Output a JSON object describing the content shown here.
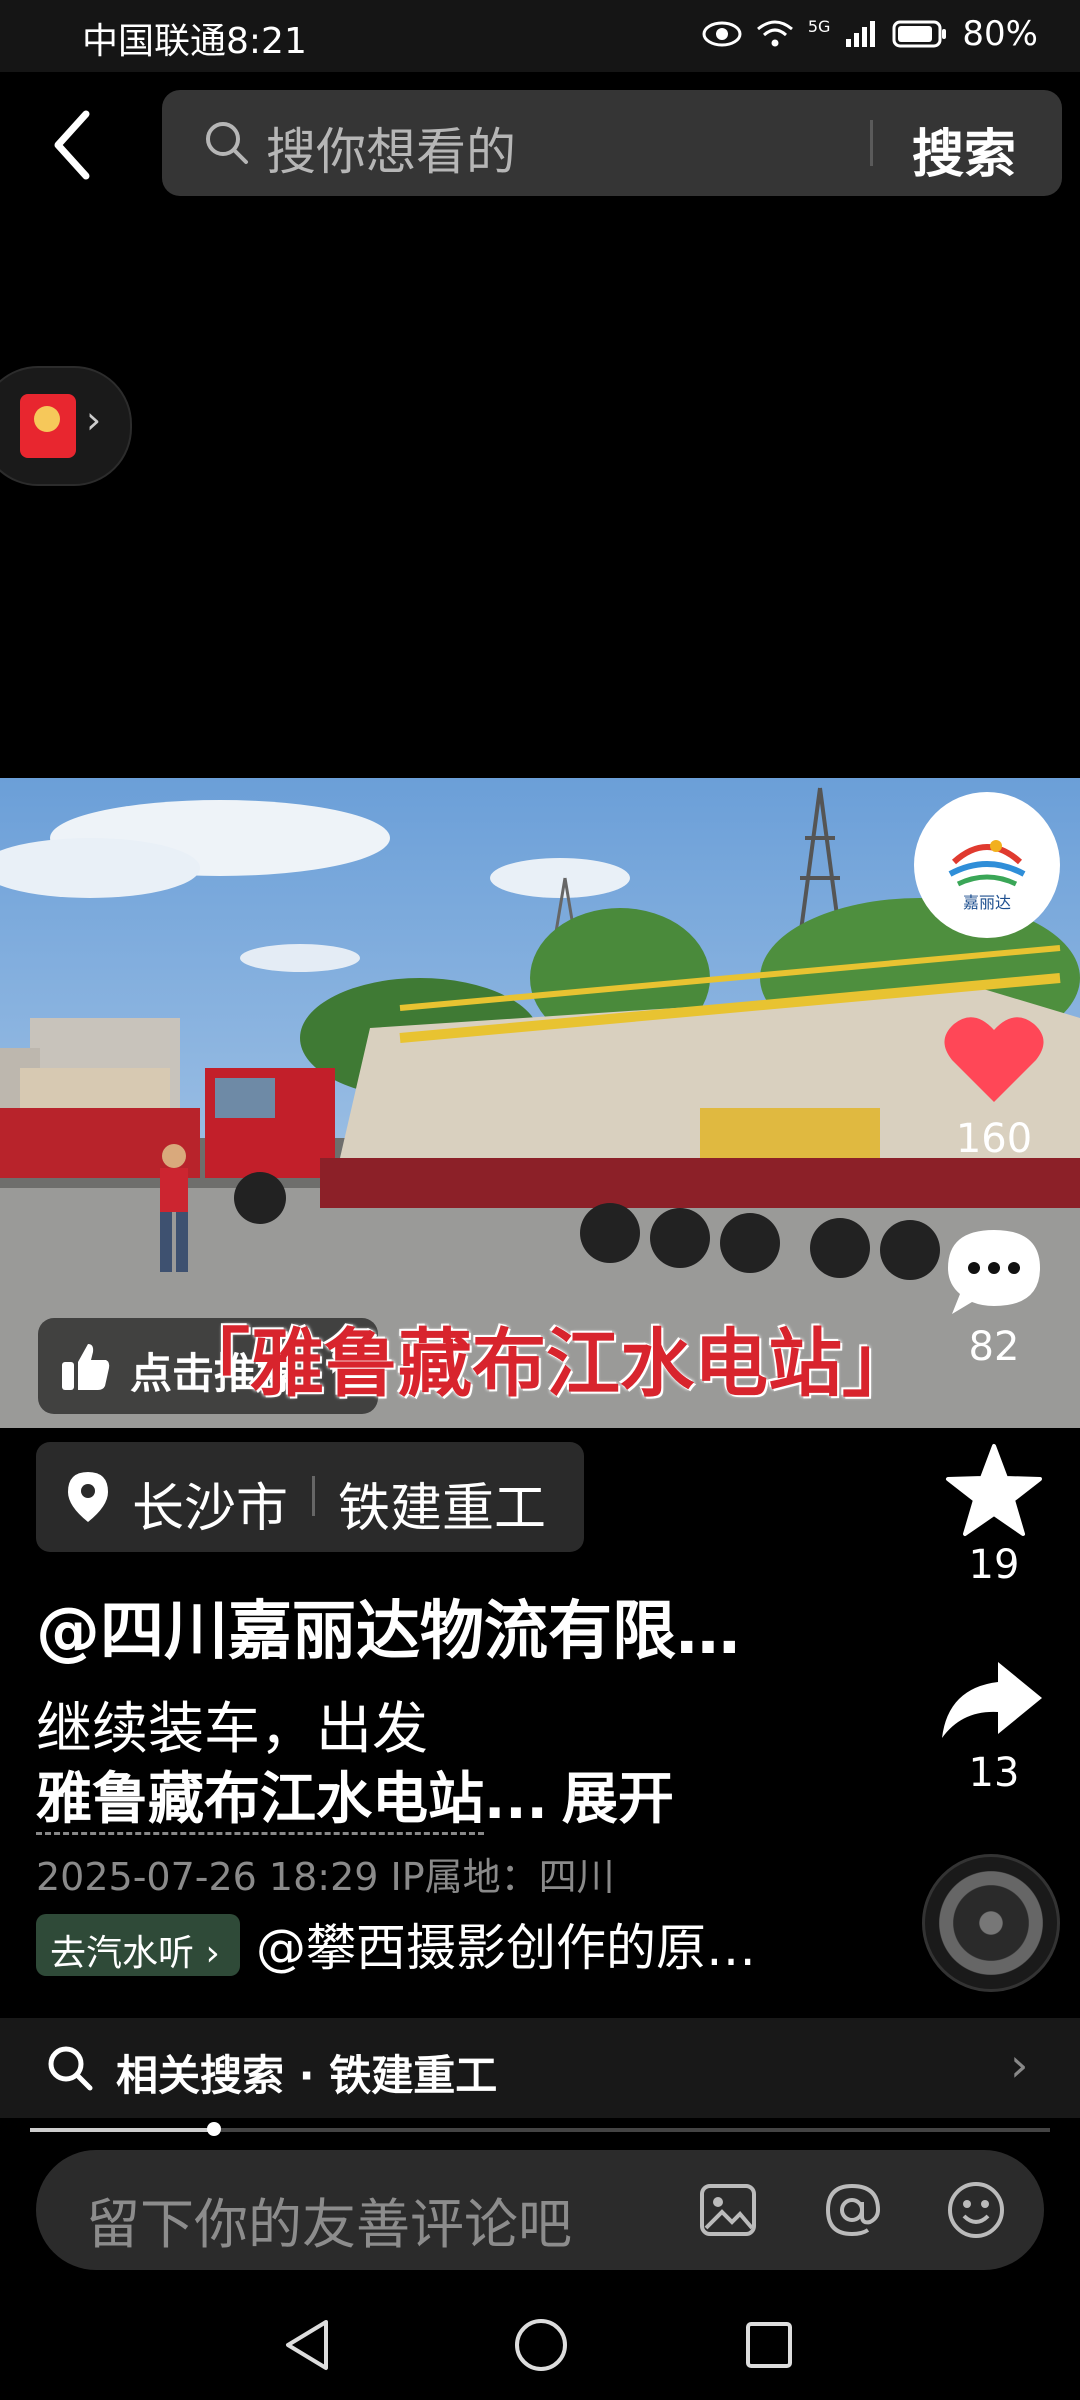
{
  "status_bar": {
    "carrier_time": "中国联通8:21",
    "network": "5G",
    "battery": "80%"
  },
  "search": {
    "placeholder": "搜你想看的",
    "button": "搜索"
  },
  "video": {
    "recommend_label": "点击推荐",
    "caption": "「雅鲁藏布江水电站」",
    "brand_logo_text": "嘉丽达"
  },
  "actions": {
    "likes": "160",
    "comments": "82",
    "favorites": "19",
    "shares": "13"
  },
  "post": {
    "location_city": "长沙市",
    "location_poi": "铁建重工",
    "author": "@四川嘉丽达物流有限…",
    "description_line1": "继续装车，出发",
    "description_tag": "雅鲁藏布江水电站",
    "description_ellipsis": "...",
    "expand": "展开",
    "timestamp": "2025-07-26 18:29  IP属地：四川",
    "music_chip": "去汽水听",
    "music_source": "@攀西摄影创作的原…"
  },
  "related_search": {
    "label": "相关搜索 · 铁建重工"
  },
  "progress": {
    "fraction": 0.18
  },
  "comment": {
    "placeholder": "留下你的友善评论吧"
  },
  "colors": {
    "like": "#ff4757",
    "accent_red": "#d8242d"
  },
  "icons": [
    "back-icon",
    "search-icon",
    "red-packet-icon",
    "heart-icon",
    "comment-icon",
    "star-icon",
    "share-icon",
    "location-pin-icon",
    "thumb-up-icon",
    "image-icon",
    "at-icon",
    "emoji-icon",
    "nav-back-icon",
    "nav-home-icon",
    "nav-recents-icon"
  ]
}
